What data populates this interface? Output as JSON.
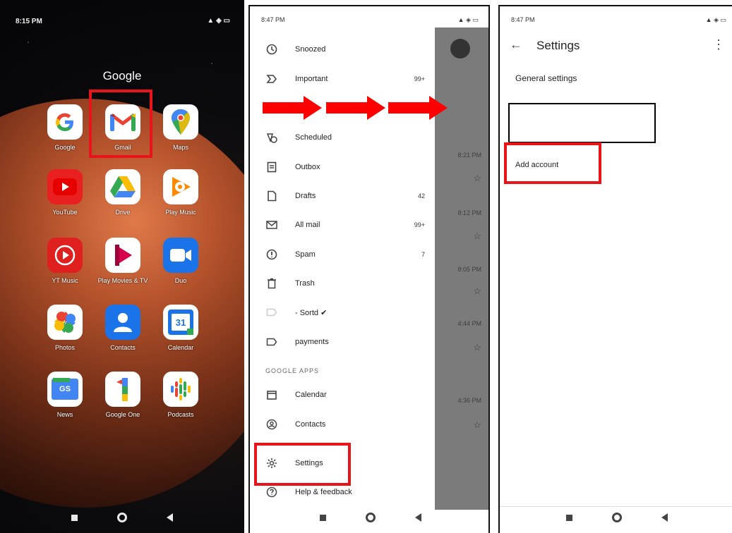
{
  "panel1": {
    "status_time": "8:15 PM",
    "status_icons": "▲ ◈ ▭",
    "folder_title": "Google",
    "apps": [
      {
        "label": "Google",
        "icon": "google-g-icon"
      },
      {
        "label": "Gmail",
        "icon": "gmail-icon"
      },
      {
        "label": "Maps",
        "icon": "maps-pin-icon"
      },
      {
        "label": "YouTube",
        "icon": "youtube-icon"
      },
      {
        "label": "Drive",
        "icon": "drive-icon"
      },
      {
        "label": "Play Music",
        "icon": "play-music-icon"
      },
      {
        "label": "YT Music",
        "icon": "yt-music-icon"
      },
      {
        "label": "Play Movies & TV",
        "icon": "play-movies-icon"
      },
      {
        "label": "Duo",
        "icon": "duo-camera-icon"
      },
      {
        "label": "Photos",
        "icon": "photos-pinwheel-icon"
      },
      {
        "label": "Contacts",
        "icon": "contacts-person-icon"
      },
      {
        "label": "Calendar",
        "icon": "calendar-icon"
      },
      {
        "label": "News",
        "icon": "news-icon"
      },
      {
        "label": "Google One",
        "icon": "google-one-icon"
      },
      {
        "label": "Podcasts",
        "icon": "podcasts-icon"
      }
    ],
    "calendar_day": "31",
    "news_badge": "GS"
  },
  "panel2": {
    "status_time": "8:47 PM",
    "drawer_items": [
      {
        "label": "Snoozed",
        "icon": "snooze-clock-icon",
        "count": ""
      },
      {
        "label": "Important",
        "icon": "important-label-icon",
        "count": "99+"
      },
      {
        "label": "Scheduled",
        "icon": "scheduled-icon",
        "count": ""
      },
      {
        "label": "Outbox",
        "icon": "outbox-icon",
        "count": ""
      },
      {
        "label": "Drafts",
        "icon": "draft-icon",
        "count": "42"
      },
      {
        "label": "All mail",
        "icon": "all-mail-icon",
        "count": "99+"
      },
      {
        "label": "Spam",
        "icon": "spam-icon",
        "count": "7"
      },
      {
        "label": "Trash",
        "icon": "trash-icon",
        "count": ""
      },
      {
        "label": "- Sortd ✔",
        "icon": "label-icon",
        "count": ""
      },
      {
        "label": "payments",
        "icon": "label-icon",
        "count": ""
      }
    ],
    "section_label": "GOOGLE APPS",
    "app_items": [
      {
        "label": "Calendar",
        "icon": "calendar-icon"
      },
      {
        "label": "Contacts",
        "icon": "contacts-icon"
      }
    ],
    "settings_label": "Settings",
    "help_label": "Help & feedback",
    "bg_times": [
      "8:21 PM",
      "8:12 PM",
      "8:05 PM",
      "4:44 PM",
      "4:36 PM"
    ]
  },
  "panel3": {
    "status_time": "8:47 PM",
    "title": "Settings",
    "general_settings": "General settings",
    "add_account": "Add account"
  },
  "colors": {
    "highlight": "#e8141a",
    "arrow": "#ff0000"
  }
}
